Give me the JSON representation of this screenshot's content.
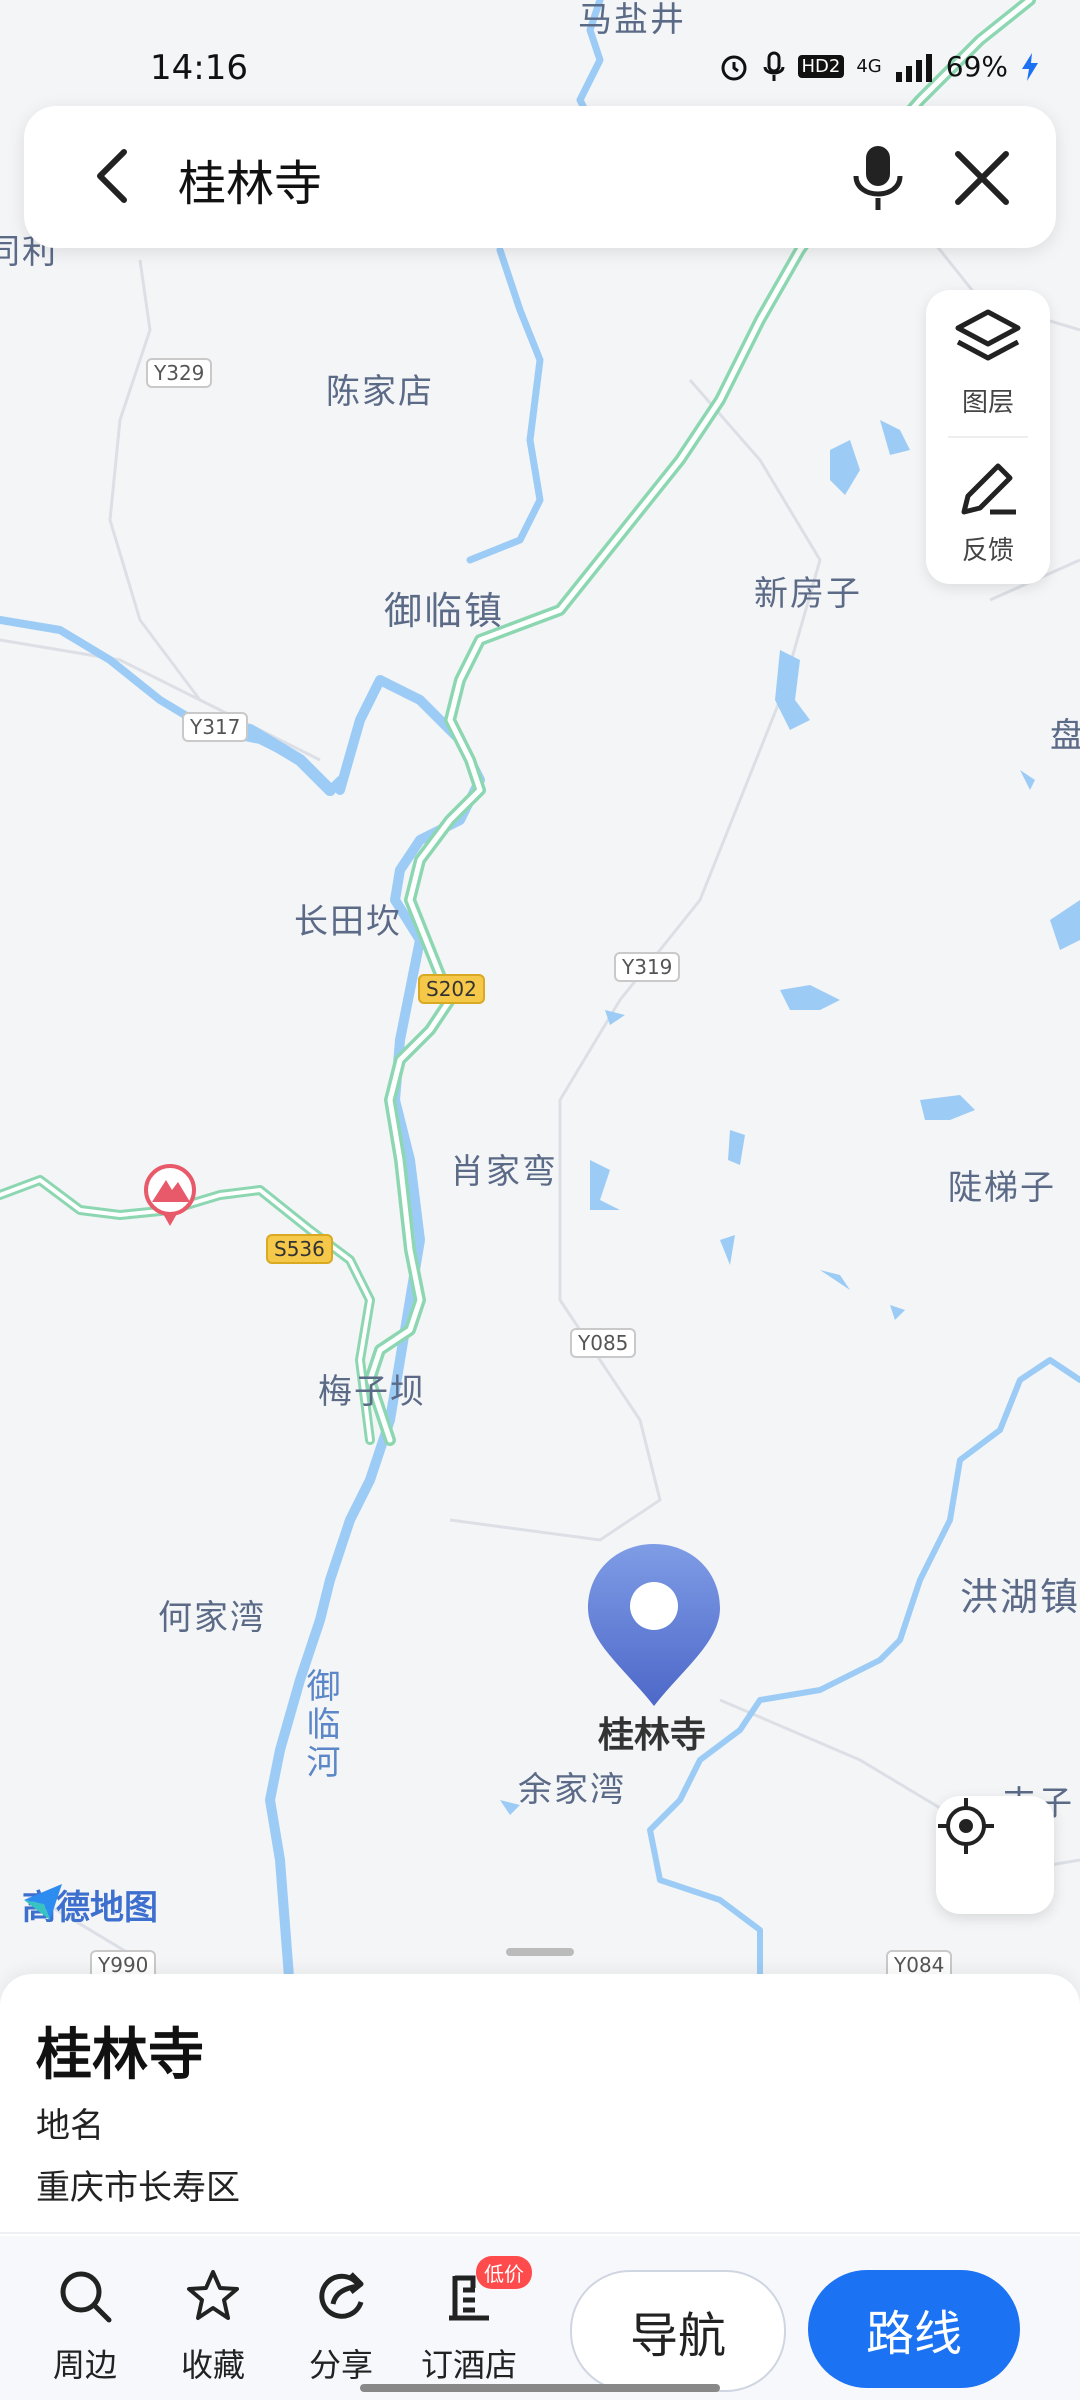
{
  "status_bar": {
    "time": "14:16",
    "battery": "69%",
    "network": "4G",
    "hd": "HD2"
  },
  "search": {
    "query": "桂林寺"
  },
  "tools": {
    "layers": "图层",
    "feedback": "反馈"
  },
  "map_labels": {
    "top": "马盐井",
    "left_edge": "同利",
    "chenjiadian": "陈家店",
    "yulinzhen": "御临镇",
    "xinfangzi": "新房子",
    "pan": "盘",
    "changtiankan": "长田坎",
    "xiaojiawan": "肖家弯",
    "doutizi": "陡梯子",
    "meiziba": "梅子坝",
    "hejiawan": "何家湾",
    "honghuzhen": "洪湖镇",
    "yujiawan": "余家湾",
    "river": "御临河",
    "wanzi": "丰子"
  },
  "roads": {
    "y329": "Y329",
    "y317": "Y317",
    "s202": "S202",
    "y319": "Y319",
    "s536": "S536",
    "y085": "Y085",
    "y990": "Y990",
    "y084": "Y084"
  },
  "poi": {
    "name": "桂林寺"
  },
  "brand": {
    "name": "高德地图"
  },
  "place": {
    "title": "桂林寺",
    "type": "地名",
    "address": "重庆市长寿区"
  },
  "actions": {
    "nearby": "周边",
    "favorite": "收藏",
    "share": "分享",
    "hotel": "订酒店",
    "hotel_badge": "低价",
    "navigate": "导航",
    "route": "路线"
  },
  "colors": {
    "accent": "#1b72f3",
    "water": "#9cccf6",
    "highway": "#a4e2c4",
    "pin": "#5e7fd6"
  }
}
